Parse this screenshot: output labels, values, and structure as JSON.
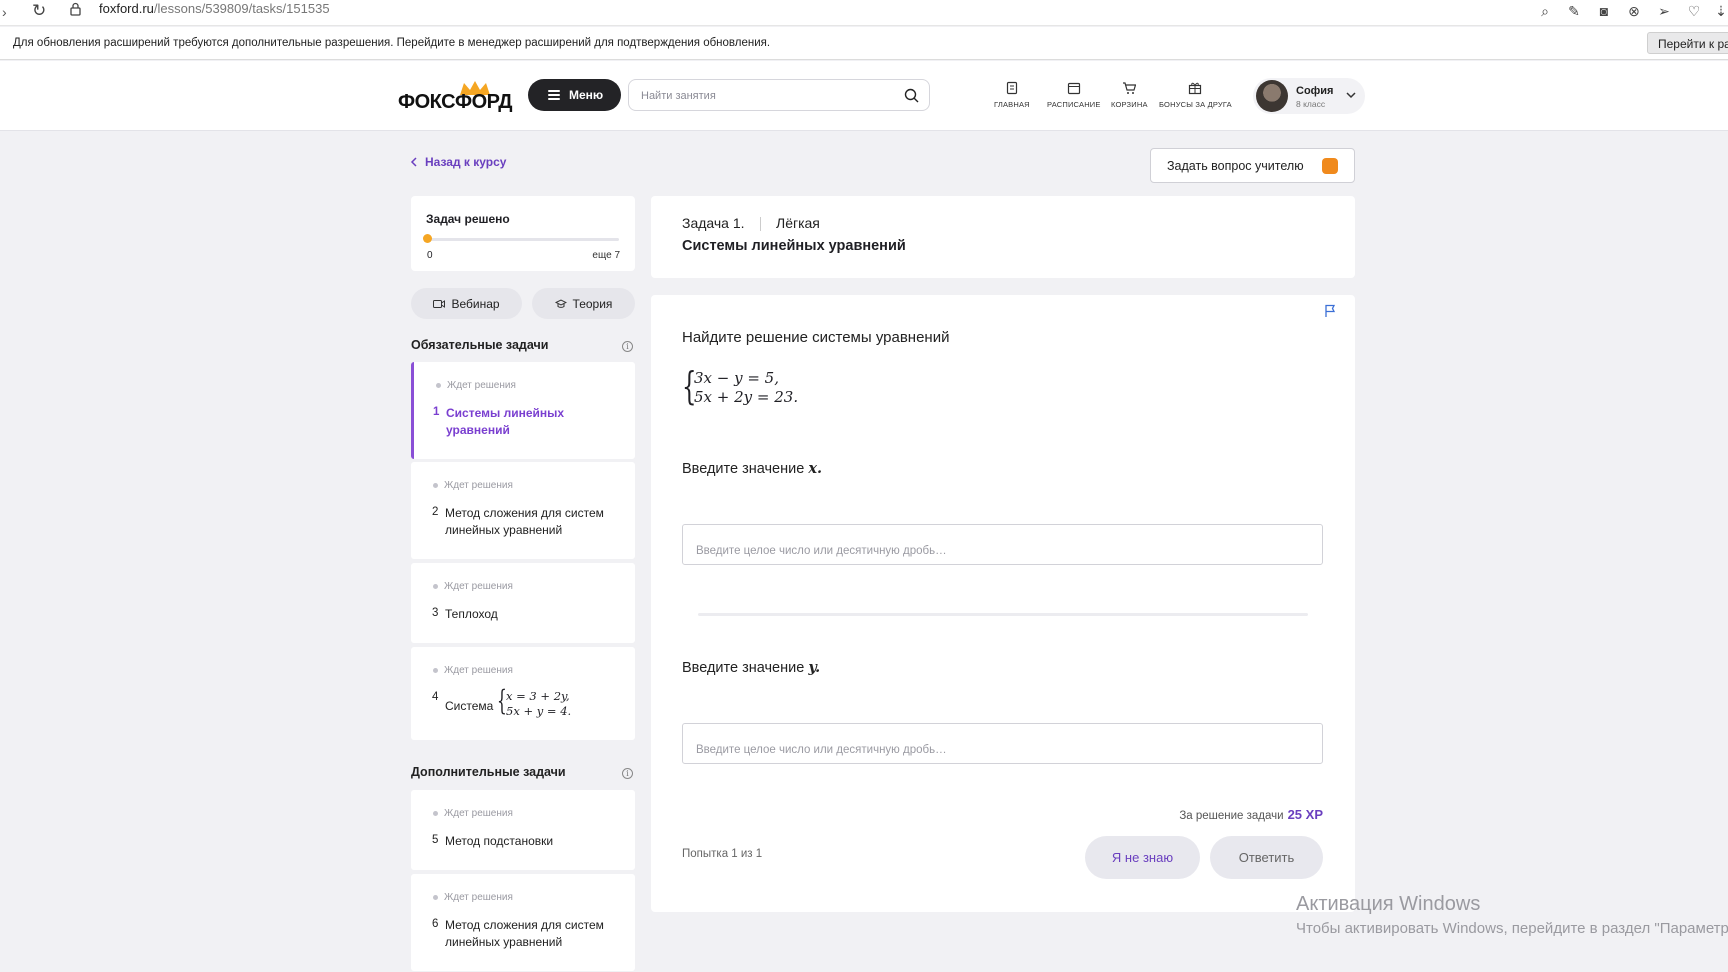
{
  "browser": {
    "url_host": "foxford.ru",
    "url_path": "/lessons/539809/tasks/151535"
  },
  "notice": {
    "text": "Для обновления расширений требуются дополнительные разрешения. Перейдите в менеджер расширений для подтверждения обновления.",
    "button": "Перейти к ра"
  },
  "header": {
    "logo": "ФОКСФОРД",
    "menu_label": "Меню",
    "search_placeholder": "Найти занятия",
    "nav": [
      {
        "label": "ГЛАВНАЯ",
        "icon": "home-icon"
      },
      {
        "label": "РАСПИСАНИЕ",
        "icon": "calendar-icon"
      },
      {
        "label": "КОРЗИНА",
        "icon": "cart-icon"
      },
      {
        "label": "БОНУСЫ ЗА ДРУГА",
        "icon": "gift-icon"
      }
    ],
    "profile": {
      "name": "София",
      "grade": "8 класс"
    }
  },
  "back_link": "Назад к курсу",
  "ask_teacher": "Задать вопрос учителю",
  "progress": {
    "title": "Задач решено",
    "solved": "0",
    "remaining": "еще 7",
    "fraction": 0.0
  },
  "tabs": {
    "webinar": "Вебинар",
    "theory": "Теория"
  },
  "sections": {
    "required": "Обязательные задачи",
    "extra": "Дополнительные задачи"
  },
  "tasks": [
    {
      "status": "Ждет решения",
      "num": "1",
      "name": "Системы линейных уравнений"
    },
    {
      "status": "Ждет решения",
      "num": "2",
      "name": "Метод сложения для систем линейных уравнений"
    },
    {
      "status": "Ждет решения",
      "num": "3",
      "name": "Теплоход"
    },
    {
      "status": "Ждет решения",
      "num": "4",
      "name": "Система",
      "eq1": "x = 3 + 2y,",
      "eq2": "5x + y = 4."
    },
    {
      "status": "Ждет решения",
      "num": "5",
      "name": "Метод подстановки"
    },
    {
      "status": "Ждет решения",
      "num": "6",
      "name": "Метод сложения для систем линейных уравнений"
    }
  ],
  "task_card": {
    "number": "Задача 1.",
    "level": "Лёгкая",
    "title": "Системы линейных уравнений",
    "question": "Найдите решение системы уравнений",
    "eq1": "3x − y = 5,",
    "eq2": "5x + 2y = 23.",
    "prompt_x_label": "Введите значение",
    "prompt_x_var": "x.",
    "prompt_y_label": "Введите значение",
    "prompt_y_var": "y.",
    "input_placeholder": "Введите целое число или десятичную дробь…",
    "reward_label": "За решение задачи",
    "reward_value": "25 XP",
    "attempt": "Попытка 1 из 1",
    "idk_button": "Я не знаю",
    "answer_button": "Ответить"
  },
  "watermark": {
    "title": "Активация Windows",
    "text": "Чтобы активировать Windows, перейдите в раздел \"Параметры\"."
  }
}
